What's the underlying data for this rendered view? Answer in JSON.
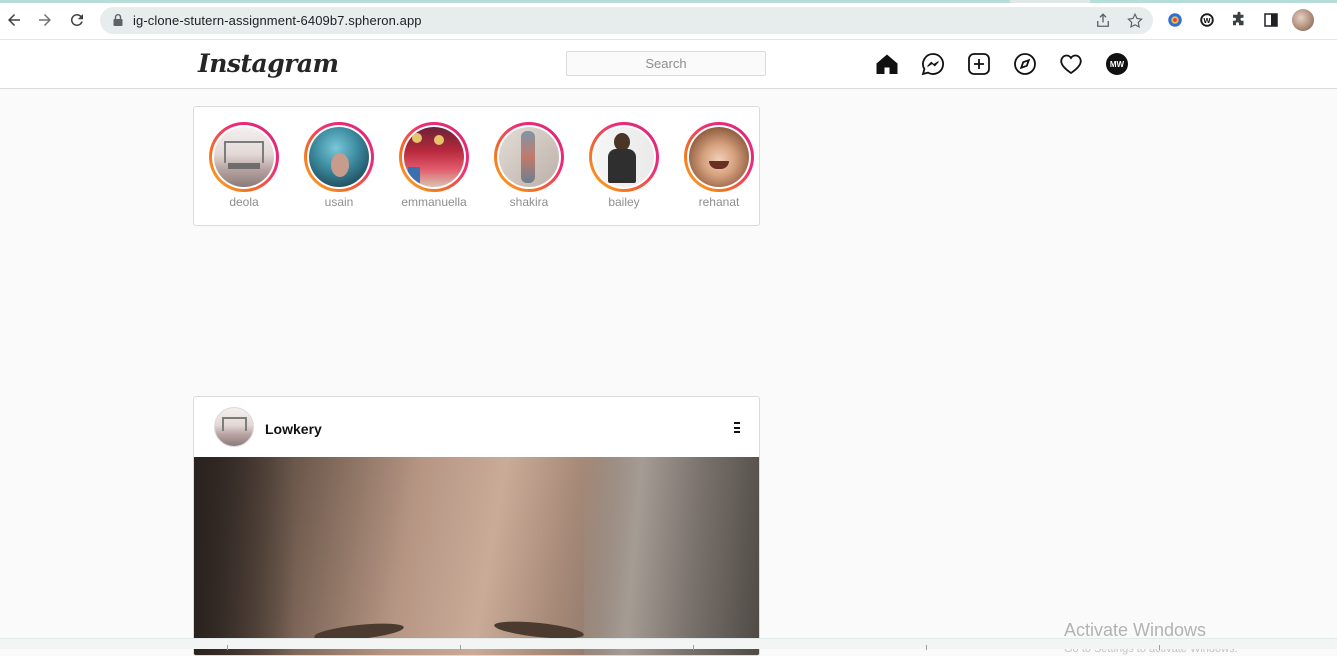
{
  "browser": {
    "url": "ig-clone-stutern-assignment-6409b7.spheron.app"
  },
  "header": {
    "logo_text": "Instagram",
    "search_placeholder": "Search",
    "profile_initials": "MW"
  },
  "stories": [
    {
      "name": "deola",
      "colors": [
        "#e9e4e4",
        "#b99c9c",
        "#6c6c6c"
      ]
    },
    {
      "name": "usain",
      "colors": [
        "#62b3c6",
        "#2b6f86",
        "#c79c8c"
      ]
    },
    {
      "name": "emmanuella",
      "colors": [
        "#b8293c",
        "#e7c36b",
        "#3a6fb0"
      ]
    },
    {
      "name": "shakira",
      "colors": [
        "#d9d2cc",
        "#7f96a8",
        "#c27a6a"
      ]
    },
    {
      "name": "bailey",
      "colors": [
        "#f1f1f1",
        "#3a3a3a",
        "#b08b70"
      ]
    },
    {
      "name": "rehanat",
      "colors": [
        "#f3d1b8",
        "#8d5a3d",
        "#c48c68"
      ]
    }
  ],
  "post": {
    "username": "Lowkery"
  },
  "os": {
    "activate_title": "Activate Windows",
    "activate_sub": "Go to Settings to activate Windows."
  }
}
